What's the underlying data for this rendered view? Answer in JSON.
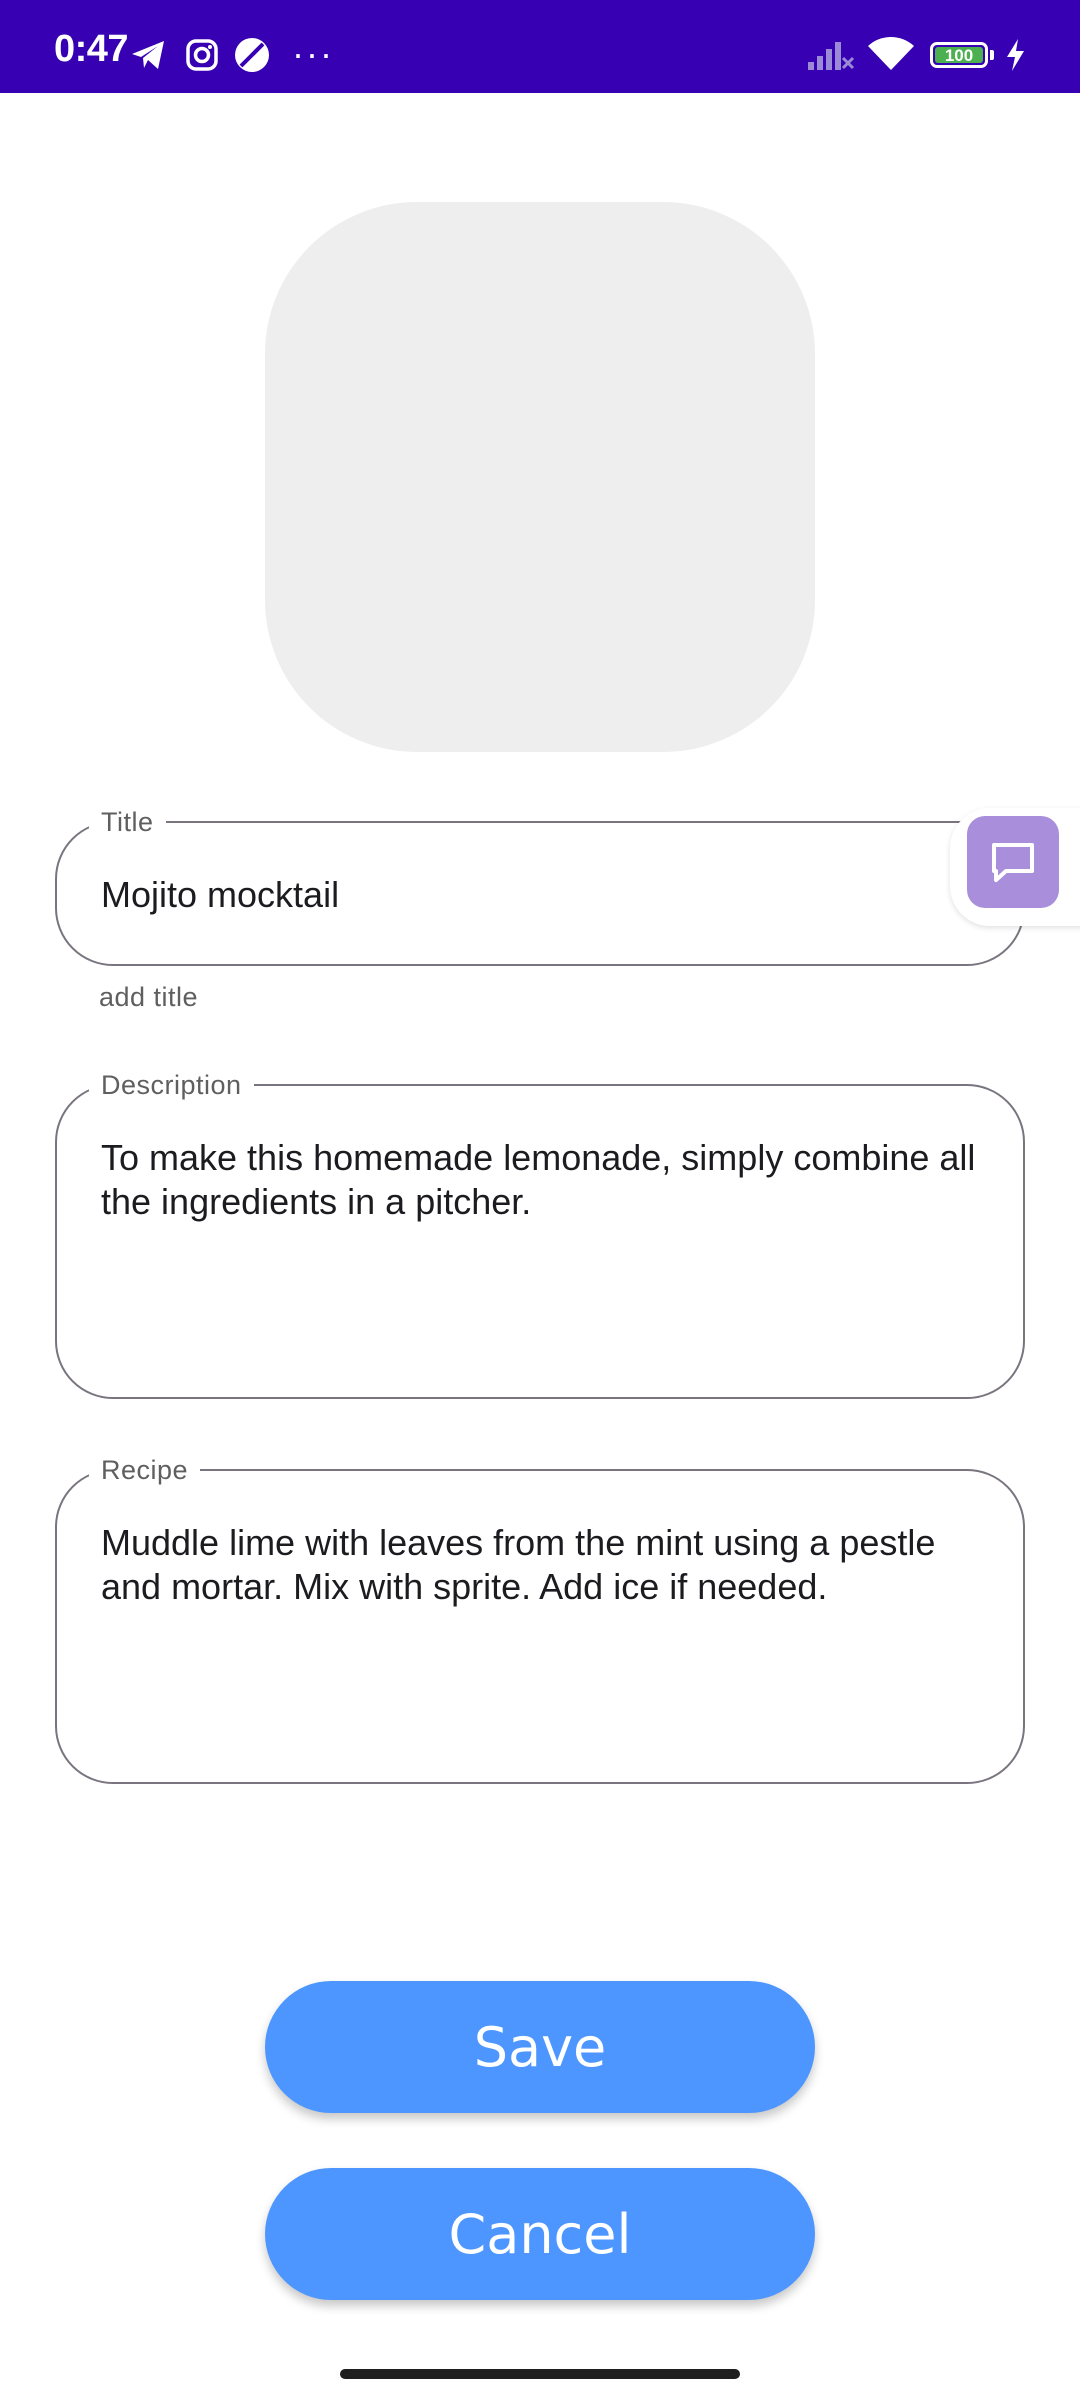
{
  "status_bar": {
    "time": "0:47",
    "battery_level": "100",
    "icons": [
      "telegram-icon",
      "instagram-icon",
      "app-circle-icon",
      "more-dots-icon",
      "signal-off-icon",
      "wifi-icon",
      "battery-icon",
      "charging-bolt-icon"
    ],
    "more": "···"
  },
  "form": {
    "title": {
      "label": "Title",
      "value": "Mojito mocktail",
      "helper": "add title"
    },
    "description": {
      "label": "Description",
      "value": "To make this homemade lemonade, simply combine all the ingredients in a pitcher."
    },
    "recipe": {
      "label": "Recipe",
      "value": "Muddle lime with leaves from the mint using a pestle and mortar. Mix with sprite. Add ice if needed."
    }
  },
  "actions": {
    "save_label": "Save",
    "cancel_label": "Cancel"
  },
  "colors": {
    "status_bar": "#3700b3",
    "button": "#4d96ff",
    "image_placeholder": "#eeeeee",
    "chat_button": "#a98fdb",
    "field_border": "#79747e"
  }
}
